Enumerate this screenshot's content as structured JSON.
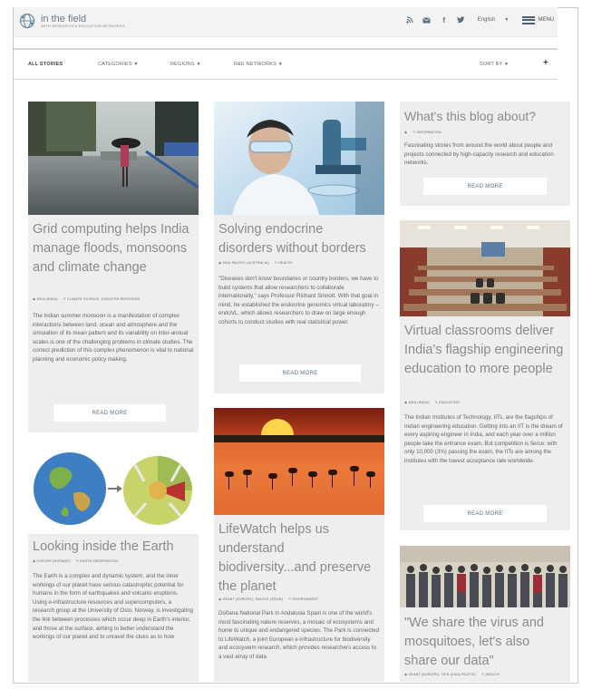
{
  "header": {
    "logo_title": "in the field",
    "logo_subtitle": "WITH RESEARCH & EDUCATION NETWORKS",
    "language": "English",
    "menu_label": "MENU",
    "icons": [
      "rss-icon",
      "email-icon",
      "facebook-icon",
      "twitter-icon"
    ]
  },
  "filters": {
    "all_stories": "ALL STORIES",
    "categories": "CATEGORIES",
    "regions": "REGIONS",
    "networks": "R&E NETWORKS",
    "sort_by": "SORT BY",
    "add": "+"
  },
  "about": {
    "title": "What's this blog about?",
    "tag": "INFORMATION",
    "text": "Fascinating stories from around the world about people and projects connected by high-capacity research and education networks.",
    "button": "READ MORE"
  },
  "cards": {
    "grid": {
      "title": "Grid computing helps India manage floods, monsoons and climate change",
      "tag_region": "ASIA (INDIA)",
      "tag_category": "CLIMATE SCIENCE, DISASTER RESPONSE",
      "text": "The Indian summer monsoon is a manifestation of complex interactions between land, ocean and atmosphere and the simulation of its mean pattern and its variability on inter-annual scales is one of the challenging problems in climate studies. The correct prediction of this complex phenomenon is vital to national planning and economic policy making.",
      "button": "READ MORE"
    },
    "endocrine": {
      "title": "Solving endocrine disorders without borders",
      "tag_region": "ASIA-PACIFIC (AUSTRALIA)",
      "tag_category": "HEALTH",
      "text": "\"Diseases don't know boundaries or country borders, we have to build systems that allow researchers to collaborate internationally,\" says Professor Richard Sinnott. With that goal in mind, he established the endocrine genomics virtual laboratory – endoVL, which allows researchers to draw on large enough cohorts to conduct studies with real statistical power.",
      "button": "READ MORE"
    },
    "virtual": {
      "title": "Virtual classrooms deliver India's flagship engineering education to more people",
      "tag_region": "ASIA (INDIA)",
      "tag_category": "EDUCATION",
      "text": "The Indian Institutes of Technology, IITs, are the flagships of Indian engineering education. Getting into an IIT is the dream of every aspiring engineer in India, and each year over a million people take the entrance exam. But competition is fierce: with only 10,000 (3%) passing the exam, the IITs are among the institutes with the lowest acceptance rate worldwide.",
      "button": "READ MORE"
    },
    "earth": {
      "title": "Looking inside the Earth",
      "tag_region": "EUROPE (NORWAY)",
      "tag_category": "EARTH OBSERVATION",
      "text": "The Earth is a complex and dynamic system, and the inner workings of our planet have serious catastrophic potential for humans in the form of earthquakes and volcanic eruptions. Using e-infrastructure resources and supercomputers, a research group at the University of Oslo, Norway, is investigating the link between processes which occur deep in Earth's interior, and those at the surface, aiming to better understand the workings of our planet and to unravel the clues as to how"
    },
    "lifewatch": {
      "title": "LifeWatch helps us understand biodiversity...and preserve the planet",
      "tag_region": "GEANT (EUROPE), RADIOS (SPAIN)",
      "tag_category": "ENVIRONMENT",
      "text": "Doñana National Park in Andalusia Spain is one of the world's most fascinating nature reserves, a mosaic of ecosystems and home to unique and endangered species. The Park is connected to LifeWatch, a joint European e-infrastructure for biodiversity and ecosystem research, which provides researchers access to a vast array of data"
    },
    "virus": {
      "title": "\"We share the virus and mosquitoes, let's also share our data\"",
      "tag_region": "GEANT (EUROPE), TEIN (ASIA-PACIFIC)",
      "tag_category": "HEALTH"
    }
  }
}
